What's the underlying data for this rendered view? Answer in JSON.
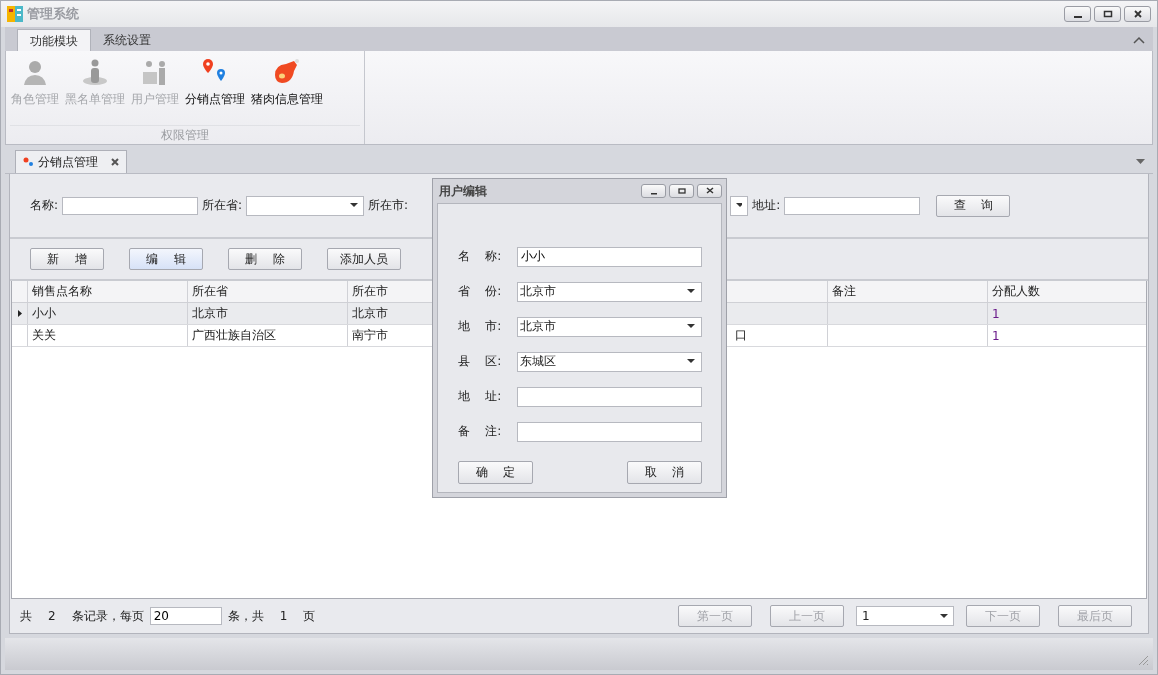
{
  "window": {
    "title": "管理系统"
  },
  "ribbon": {
    "tabs": [
      {
        "label": "功能模块",
        "selected": true
      },
      {
        "label": "系统设置",
        "selected": false
      }
    ],
    "items": [
      {
        "label": "角色管理",
        "kind": "role",
        "disabled": true
      },
      {
        "label": "黑名单管理",
        "kind": "blacklist",
        "disabled": true
      },
      {
        "label": "用户管理",
        "kind": "users",
        "disabled": true
      },
      {
        "label": "分销点管理",
        "kind": "pins",
        "disabled": false
      },
      {
        "label": "猪肉信息管理",
        "kind": "meat",
        "disabled": false
      }
    ],
    "group_label": "权限管理"
  },
  "doc_tab": {
    "label": "分销点管理"
  },
  "search": {
    "name_label": "名称:",
    "province_label": "所在省:",
    "city_label": "所在市:",
    "address_label": "地址:",
    "query_button": "查    询"
  },
  "actions": [
    {
      "label": "新    增",
      "highlighted": false
    },
    {
      "label": "编    辑",
      "highlighted": true
    },
    {
      "label": "删    除",
      "highlighted": false
    },
    {
      "label": "添加人员",
      "highlighted": false
    }
  ],
  "table": {
    "columns": [
      "销售点名称",
      "所在省",
      "所在市",
      "备注",
      "分配人数"
    ],
    "rows": [
      {
        "name": "小小",
        "province": "北京市",
        "city": "北京市",
        "count": "1",
        "selected": true
      },
      {
        "name": "关关",
        "province": "广西壮族自治区",
        "city": "南宁市",
        "column_4": "口",
        "count": "1",
        "selected": false
      }
    ]
  },
  "pager": {
    "prefix": "共",
    "total": "2",
    "records_label": "条记录，每页",
    "page_size": "20",
    "pages_label": "条，共",
    "pages": "1",
    "suffix": "页",
    "first": "第一页",
    "prev": "上一页",
    "current": "1",
    "next": "下一页",
    "last": "最后页"
  },
  "dialog": {
    "title": "用户编辑",
    "fields": [
      {
        "label": "名    称:",
        "kind": "text",
        "value": "小小"
      },
      {
        "label": "省    份:",
        "kind": "combo",
        "value": "北京市"
      },
      {
        "label": "地    市:",
        "kind": "combo",
        "value": "北京市"
      },
      {
        "label": "县    区:",
        "kind": "combo",
        "value": "东城区"
      },
      {
        "label": "地    址:",
        "kind": "text"
      },
      {
        "label": "备    注:",
        "kind": "text"
      }
    ],
    "ok": "确    定",
    "cancel": "取    消"
  }
}
